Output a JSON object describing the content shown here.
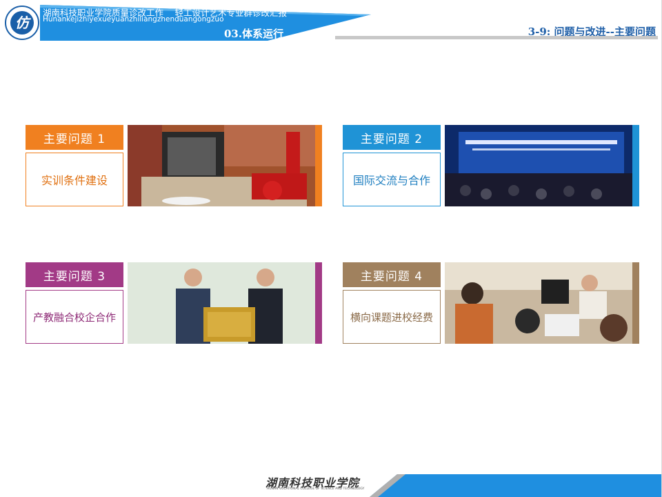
{
  "header": {
    "title": "湖南科技职业学院质量诊改工作　 轻工设计艺术专业群诊改汇报",
    "pinyin": "Hunankejizhiyexueyuanzhiliangzhenduangongzuo",
    "section": "03.体系运行",
    "page_title": "3-9: 问题与改进--主要问题",
    "logo_glyph": "仿",
    "color_blue": "#1f8fe0"
  },
  "cards": [
    {
      "tag": "主要问题 1",
      "text": "实训条件建设",
      "color": "#f08020",
      "photo": "workshop-with-red-machine"
    },
    {
      "tag": "主要问题 2",
      "text": "国际交流与合作",
      "color": "#1f93d6",
      "photo": "international-forum-stage"
    },
    {
      "tag": "主要问题 3",
      "text": "产教融合校企合作",
      "color": "#a23a86",
      "photo": "plaque-presentation"
    },
    {
      "tag": "主要问题 4",
      "text": "横向课题进校经费",
      "color": "#a0815e",
      "photo": "computer-lab-students"
    }
  ],
  "footer": {
    "school_cn": "湖南科技职业学院",
    "school_en": "HUNAN VOCATIONAL COLLEGE OF SCIENCE AND TECHNOLOGY"
  }
}
